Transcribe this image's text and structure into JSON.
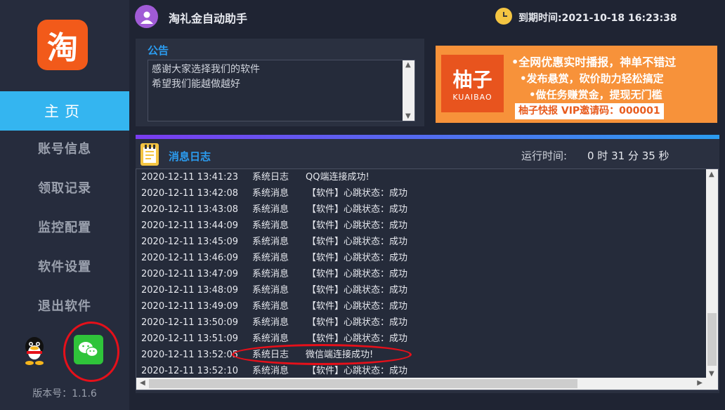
{
  "sidebar": {
    "logo_char": "淘",
    "items": [
      {
        "label": "主页"
      },
      {
        "label": "账号信息"
      },
      {
        "label": "领取记录"
      },
      {
        "label": "监控配置"
      },
      {
        "label": "软件设置"
      },
      {
        "label": "退出软件"
      }
    ],
    "version": "版本号：1.1.6"
  },
  "header": {
    "title": "淘礼金自动助手",
    "expiry": "到期时间:2021-10-18 16:23:38"
  },
  "notice": {
    "title": "公告",
    "lines": [
      "感谢大家选择我们的软件",
      "希望我们能越做越好"
    ]
  },
  "ad": {
    "logo_text": "柚子",
    "logo_sub": "KUAIBAO",
    "line1": "•全网优惠实时播报，神单不错过",
    "line2": "•发布悬赏，砍价助力轻松搞定",
    "line3": "•做任务赚赏金，提现无门槛",
    "code": "柚子快报  VIP邀请码：000001"
  },
  "log": {
    "title": "消息日志",
    "runtime_label": "运行时间:",
    "runtime_value": "0 时 31 分 35 秒",
    "rows": [
      {
        "time": "2020-12-11 13:41:23",
        "type": "系统日志",
        "msg": "QQ端连接成功!"
      },
      {
        "time": "2020-12-11 13:42:08",
        "type": "系统消息",
        "msg": "【软件】心跳状态：成功"
      },
      {
        "time": "2020-12-11 13:43:08",
        "type": "系统消息",
        "msg": "【软件】心跳状态：成功"
      },
      {
        "time": "2020-12-11 13:44:09",
        "type": "系统消息",
        "msg": "【软件】心跳状态：成功"
      },
      {
        "time": "2020-12-11 13:45:09",
        "type": "系统消息",
        "msg": "【软件】心跳状态：成功"
      },
      {
        "time": "2020-12-11 13:46:09",
        "type": "系统消息",
        "msg": "【软件】心跳状态：成功"
      },
      {
        "time": "2020-12-11 13:47:09",
        "type": "系统消息",
        "msg": "【软件】心跳状态：成功"
      },
      {
        "time": "2020-12-11 13:48:09",
        "type": "系统消息",
        "msg": "【软件】心跳状态：成功"
      },
      {
        "time": "2020-12-11 13:49:09",
        "type": "系统消息",
        "msg": "【软件】心跳状态：成功"
      },
      {
        "time": "2020-12-11 13:50:09",
        "type": "系统消息",
        "msg": "【软件】心跳状态：成功"
      },
      {
        "time": "2020-12-11 13:51:09",
        "type": "系统消息",
        "msg": "【软件】心跳状态：成功"
      },
      {
        "time": "2020-12-11 13:52:05",
        "type": "系统日志",
        "msg": "微信端连接成功!"
      },
      {
        "time": "2020-12-11 13:52:10",
        "type": "系统消息",
        "msg": "【软件】心跳状态：成功"
      }
    ]
  },
  "colors": {
    "accent": "#34b5f0",
    "title_blue": "#2b9cf0",
    "highlight_red": "#e5101a",
    "brand_orange": "#f25a1a"
  }
}
